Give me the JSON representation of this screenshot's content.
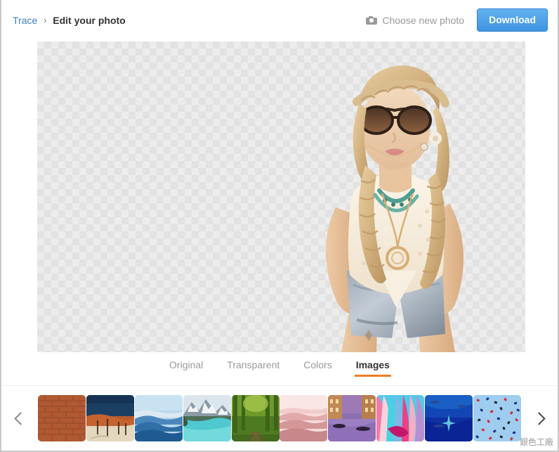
{
  "header": {
    "breadcrumb": {
      "root_label": "Trace",
      "separator": "›",
      "current_label": "Edit your photo"
    },
    "choose_photo_label": "Choose new photo",
    "download_label": "Download",
    "camera_icon": "camera-icon"
  },
  "canvas": {
    "background": "transparent-checkerboard",
    "subject_description": "cut-out photo of woman with sunglasses and braided blonde hair"
  },
  "tabs": [
    {
      "label": "Original",
      "active": false
    },
    {
      "label": "Transparent",
      "active": false
    },
    {
      "label": "Colors",
      "active": false
    },
    {
      "label": "Images",
      "active": true
    }
  ],
  "strip": {
    "prev_icon": "chevron-left-icon",
    "next_icon": "chevron-right-icon",
    "thumbnails": [
      {
        "name": "brick-wall"
      },
      {
        "name": "desert-dunes"
      },
      {
        "name": "blue-mountains"
      },
      {
        "name": "turquoise-lake"
      },
      {
        "name": "forest-path"
      },
      {
        "name": "pink-mountains"
      },
      {
        "name": "venice-canal"
      },
      {
        "name": "abstract-color"
      },
      {
        "name": "deep-blue-sea"
      },
      {
        "name": "confetti-blue"
      }
    ]
  },
  "watermark": {
    "text": "銀色工廠"
  },
  "colors": {
    "accent_orange": "#f07c21",
    "link_blue": "#3a7fc1",
    "button_blue": "#3f94e0",
    "muted_gray": "#9a9a9a"
  }
}
